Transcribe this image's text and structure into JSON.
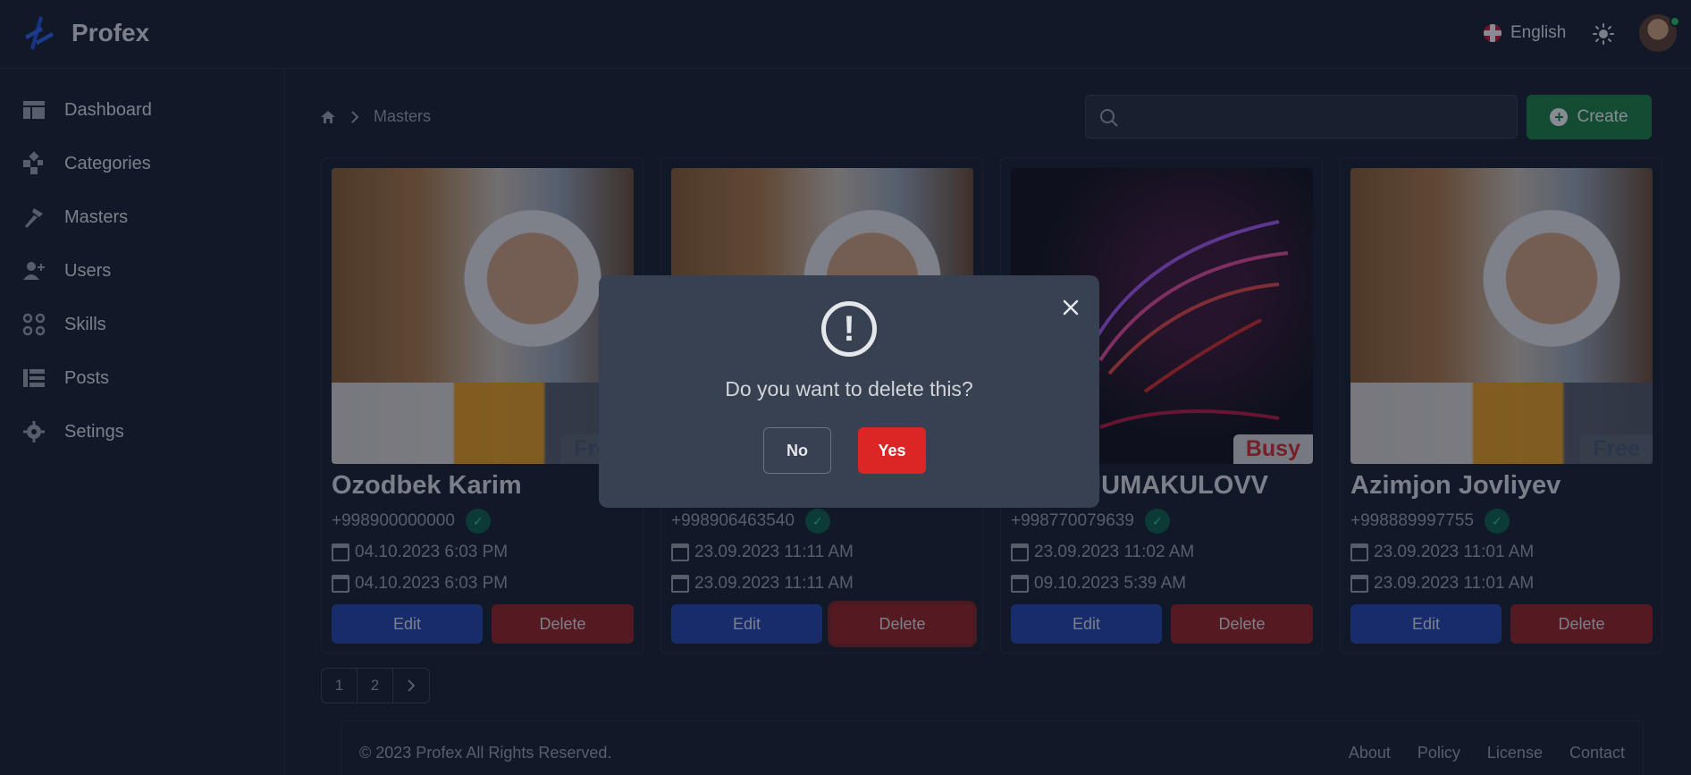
{
  "app": {
    "brand": "Profex"
  },
  "header": {
    "language": "English"
  },
  "sidebar": {
    "items": [
      {
        "label": "Dashboard",
        "icon": "dashboard-icon"
      },
      {
        "label": "Categories",
        "icon": "categories-icon"
      },
      {
        "label": "Masters",
        "icon": "hammer-icon"
      },
      {
        "label": "Users",
        "icon": "users-icon"
      },
      {
        "label": "Skills",
        "icon": "skills-icon"
      },
      {
        "label": "Posts",
        "icon": "list-icon"
      },
      {
        "label": "Setings",
        "icon": "gear-icon"
      }
    ]
  },
  "breadcrumb": {
    "current": "Masters"
  },
  "search": {
    "placeholder": ""
  },
  "create_label": "Create",
  "cards": [
    {
      "name": "Ozodbek Karim",
      "phone": "+998900000000",
      "status": "Free",
      "created": "04.10.2023 6:03 PM",
      "updated": "04.10.2023 6:03 PM",
      "edit": "Edit",
      "delete": "Delete"
    },
    {
      "name": "",
      "phone": "+998906463540",
      "status": "",
      "created": "23.09.2023 11:11 AM",
      "updated": "23.09.2023 11:11 AM",
      "edit": "Edit",
      "delete": "Delete"
    },
    {
      "name": "JUMAKULOVV",
      "phone": "+998770079639",
      "status": "Busy",
      "created": "23.09.2023 11:02 AM",
      "updated": "09.10.2023 5:39 AM",
      "edit": "Edit",
      "delete": "Delete"
    },
    {
      "name": "Azimjon Jovliyev",
      "phone": "+998889997755",
      "status": "Free",
      "created": "23.09.2023 11:01 AM",
      "updated": "23.09.2023 11:01 AM",
      "edit": "Edit",
      "delete": "Delete"
    }
  ],
  "pagination": {
    "pages": [
      "1",
      "2"
    ],
    "next": "›"
  },
  "footer": {
    "copyright": "© 2023 Profex All Rights Reserved.",
    "links": [
      "About",
      "Policy",
      "License",
      "Contact"
    ]
  },
  "modal": {
    "icon": "!",
    "message": "Do you want to delete this?",
    "no": "No",
    "yes": "Yes"
  },
  "colors": {
    "primary": "#1e40af",
    "danger": "#dc2626",
    "success": "#15803d",
    "background": "#111827"
  }
}
